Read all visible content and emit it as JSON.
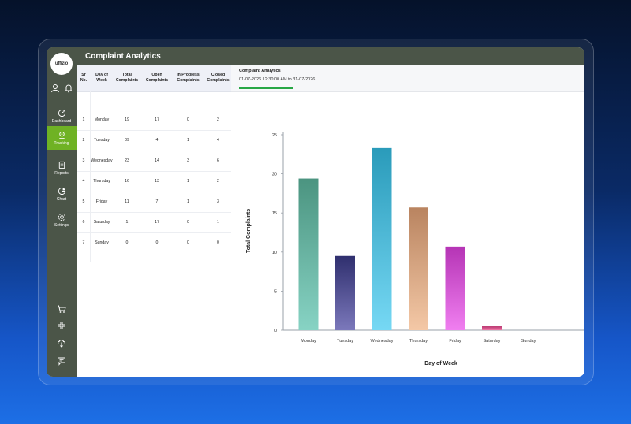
{
  "app": {
    "title": "Complaint Analytics",
    "logo_text": "uffizio"
  },
  "sidebar": {
    "top_icons": [
      {
        "icon": "user-icon"
      },
      {
        "icon": "bell-icon"
      }
    ],
    "items": [
      {
        "label": "Dashboard",
        "icon": "dashboard-icon",
        "active": false
      },
      {
        "label": "Tracking",
        "icon": "tracking-icon",
        "active": true
      },
      {
        "label": "Reports",
        "icon": "reports-icon",
        "active": false
      },
      {
        "label": "Chart",
        "icon": "pie-chart-icon",
        "active": false
      },
      {
        "label": "Settings",
        "icon": "settings-icon",
        "active": false
      }
    ],
    "bottom_icons": [
      "cart-icon",
      "grid-icon",
      "cloud-download-icon",
      "chat-icon"
    ]
  },
  "table": {
    "headers": [
      "Sr No.",
      "Day of Week",
      "Total Complaints",
      "Open Complaints",
      "In Progress Complaints",
      "Closed Complaints"
    ],
    "rows": [
      [
        "1",
        "Monday",
        "19",
        "17",
        "0",
        "2"
      ],
      [
        "2",
        "Tuesday",
        "09",
        "4",
        "1",
        "4"
      ],
      [
        "3",
        "Wednesday",
        "23",
        "14",
        "3",
        "6"
      ],
      [
        "4",
        "Thursday",
        "16",
        "13",
        "1",
        "2"
      ],
      [
        "5",
        "Friday",
        "11",
        "7",
        "1",
        "3"
      ],
      [
        "6",
        "Saturday",
        "1",
        "17",
        "0",
        "1"
      ],
      [
        "7",
        "Sunday",
        "0",
        "0",
        "0",
        "0"
      ]
    ]
  },
  "chart_panel": {
    "title": "Complaint Analytics",
    "date_range": "01-07-2026 12:30:00 AM to 31-07-2026"
  },
  "chart_data": {
    "type": "bar",
    "categories": [
      "Monday",
      "Tuesday",
      "Wednesday",
      "Thursday",
      "Friday",
      "Saturday",
      "Sunday"
    ],
    "values": [
      19.4,
      9.5,
      23.3,
      15.7,
      10.7,
      0.5,
      0
    ],
    "xlabel": "Day of Week",
    "ylabel": "Total Complaints",
    "ylim": [
      0,
      25
    ],
    "yticks": [
      0,
      5,
      10,
      15,
      20,
      25
    ],
    "bar_colors": [
      [
        "#4b9480",
        "#87d3c4"
      ],
      [
        "#2f2f6e",
        "#7b78bb"
      ],
      [
        "#2a9bba",
        "#76d8f4"
      ],
      [
        "#b98460",
        "#f4c8a6"
      ],
      [
        "#b534b5",
        "#f07ff0"
      ],
      [
        "#b8336e",
        "#f07aa8"
      ],
      [
        "#888888",
        "#bbbbbb"
      ]
    ],
    "grid": false,
    "legend": "none"
  }
}
